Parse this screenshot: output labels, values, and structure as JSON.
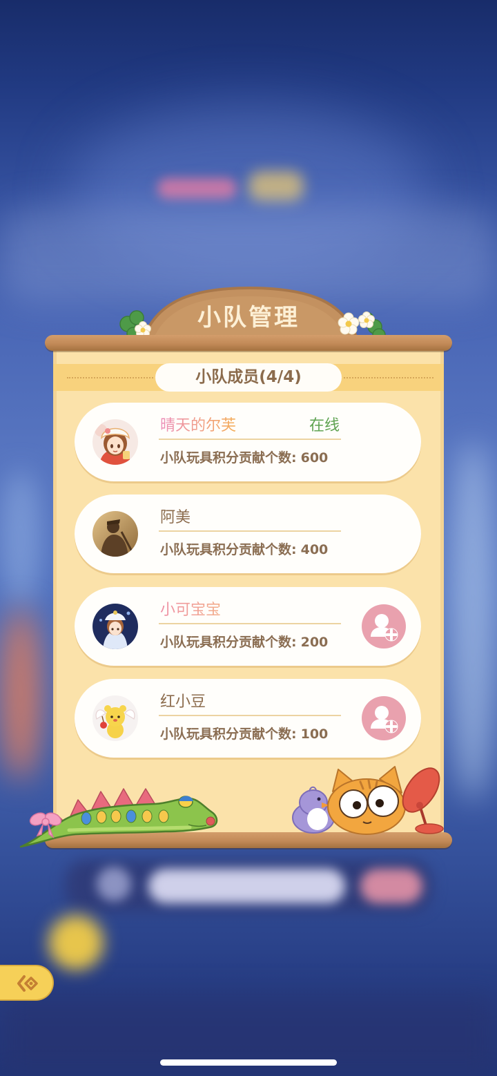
{
  "panel": {
    "title": "小队管理",
    "subtitle": "小队成员(4/4)"
  },
  "members": [
    {
      "name": "晴天的尔芙",
      "name_colors": [
        "#ec8cba",
        "#f4ae58"
      ],
      "status": "在线",
      "contribution_label": "小队玩具积分贡献个数:",
      "contribution_count": 600
    },
    {
      "name": "阿美",
      "name_colors": [
        "#8b6b4c"
      ],
      "contribution_label": "小队玩具积分贡献个数:",
      "contribution_count": 400
    },
    {
      "name": "小可宝宝",
      "name_colors": [
        "#ee8fa6",
        "#f3ae8a"
      ],
      "contribution_label": "小队玩具积分贡献个数:",
      "contribution_count": 200,
      "action_icon": "add-friend-icon"
    },
    {
      "name": "红小豆",
      "name_colors": [
        "#8b6b4c"
      ],
      "contribution_label": "小队玩具积分贡献个数:",
      "contribution_count": 100,
      "action_icon": "add-friend-icon"
    }
  ],
  "side_tab": {
    "icon": "arrow-left-icon"
  },
  "colors": {
    "online_status": "#5fa352",
    "text_brown": "#8b6b4c",
    "add_friend_button": "#e9a1ae",
    "side_tab": "#f6d058",
    "paper": "#fbe2aa"
  }
}
